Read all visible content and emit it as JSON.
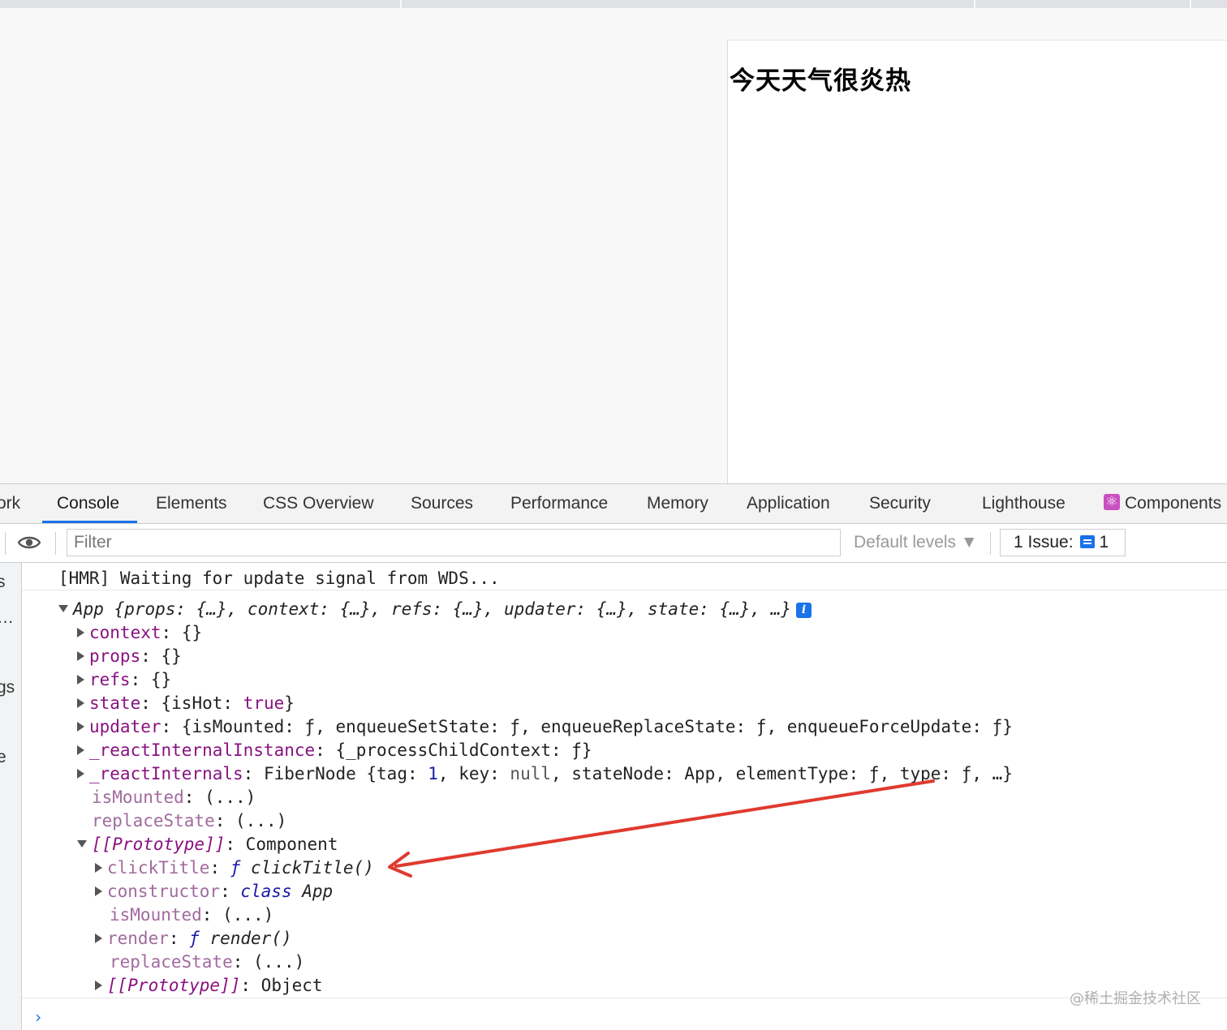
{
  "page": {
    "heading": "今天天气很炎热"
  },
  "devtools": {
    "tabs": [
      {
        "label": "ork"
      },
      {
        "label": "Console"
      },
      {
        "label": "Elements"
      },
      {
        "label": "CSS Overview"
      },
      {
        "label": "Sources"
      },
      {
        "label": "Performance"
      },
      {
        "label": "Memory"
      },
      {
        "label": "Application"
      },
      {
        "label": "Security"
      },
      {
        "label": "Lighthouse"
      },
      {
        "label": "Components"
      }
    ],
    "active_tab": "Console",
    "filter_placeholder": "Filter",
    "levels_label": "Default levels ▼",
    "issues_label": "1 Issue:",
    "issues_count": "1",
    "sidebar_fragments": [
      "s",
      "…",
      "gs",
      "e"
    ]
  },
  "console": {
    "hmr": "[HMR] Waiting for update signal from WDS...",
    "app_summary": "App {props: {…}, context: {…}, refs: {…}, updater: {…}, state: {…}, …}",
    "info_icon": "i",
    "rows": {
      "context_key": "context",
      "context_val": "{}",
      "props_key": "props",
      "props_val": "{}",
      "refs_key": "refs",
      "refs_val": "{}",
      "state_key": "state",
      "state_pre": "{isHot: ",
      "state_true": "true",
      "state_post": "}",
      "updater_key": "updater",
      "updater_val": "{isMounted: ƒ, enqueueSetState: ƒ, enqueueReplaceState: ƒ, enqueueForceUpdate: ƒ}",
      "rii_key": "_reactInternalInstance",
      "rii_val": "{_processChildContext: ƒ}",
      "ri_key": "_reactInternals",
      "ri_pre": "FiberNode {tag: ",
      "ri_num": "1",
      "ri_mid": ", key: ",
      "ri_null": "null",
      "ri_post": ", stateNode: App, elementType: ƒ, type: ƒ, …}",
      "ismounted_key": "isMounted",
      "ismounted_val": "(...)",
      "replacestate_key": "replaceState",
      "replacestate_val": "(...)",
      "proto_key": "[[Prototype]]",
      "proto_val": "Component",
      "clicktitle_key": "clickTitle",
      "clicktitle_f": "ƒ",
      "clicktitle_val": "clickTitle()",
      "constructor_key": "constructor",
      "constructor_class": "class",
      "constructor_val": "App",
      "ismounted2_key": "isMounted",
      "ismounted2_val": "(...)",
      "render_key": "render",
      "render_f": "ƒ",
      "render_val": "render()",
      "replacestate2_key": "replaceState",
      "replacestate2_val": "(...)",
      "proto2_key": "[[Prototype]]",
      "proto2_val": "Object"
    },
    "prompt": "›"
  },
  "watermark": "@稀土掘金技术社区",
  "colors": {
    "accent": "#1a73e8",
    "annotation_arrow": "#e03a2f",
    "property_key": "#881280"
  }
}
